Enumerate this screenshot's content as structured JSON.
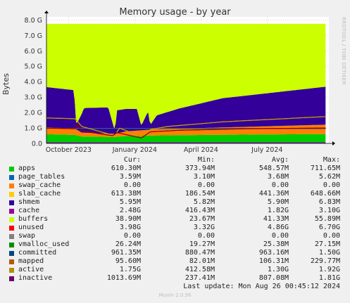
{
  "chart_data": {
    "type": "area",
    "title": "Memory usage - by year",
    "ylabel": "Bytes",
    "side_text": "RRDTOOL / TOBI OETIKER",
    "y_ticks": [
      "0.0",
      "1.0 G",
      "2.0 G",
      "3.0 G",
      "4.0 G",
      "5.0 G",
      "6.0 G",
      "7.0 G",
      "8.0 G"
    ],
    "ylim": [
      0,
      8.2
    ],
    "x_ticks": [
      {
        "label": "October 2023",
        "month": 1.0
      },
      {
        "label": "January 2024",
        "month": 4.0
      },
      {
        "label": "April 2024",
        "month": 7.0
      },
      {
        "label": "July 2024",
        "month": 10.0
      }
    ],
    "xlim": [
      0,
      12.8
    ],
    "grid": true,
    "stack_total_g": 7.75,
    "stack_series": [
      {
        "name": "apps",
        "color": "#00cc00",
        "pts": [
          [
            0,
            0.6
          ],
          [
            1.3,
            0.55
          ],
          [
            1.6,
            0.45
          ],
          [
            3.1,
            0.42
          ],
          [
            3.6,
            0.48
          ],
          [
            5.0,
            0.52
          ],
          [
            8.0,
            0.56
          ],
          [
            12.8,
            0.61
          ]
        ]
      },
      {
        "name": "slab_cache",
        "color": "#ff8000",
        "pts": [
          [
            0,
            0.45
          ],
          [
            1.3,
            0.4
          ],
          [
            1.6,
            0.25
          ],
          [
            3.1,
            0.2
          ],
          [
            3.6,
            0.3
          ],
          [
            5.0,
            0.4
          ],
          [
            9.0,
            0.5
          ],
          [
            12.8,
            0.61
          ]
        ]
      },
      {
        "name": "cache",
        "color": "#330099",
        "pts": [
          [
            0,
            2.6
          ],
          [
            1.25,
            2.5
          ],
          [
            1.35,
            0.3
          ],
          [
            1.7,
            1.6
          ],
          [
            2.8,
            1.7
          ],
          [
            3.1,
            0.2
          ],
          [
            3.2,
            1.5
          ],
          [
            4.1,
            1.4
          ],
          [
            4.3,
            0.3
          ],
          [
            4.6,
            1.2
          ],
          [
            4.7,
            0.3
          ],
          [
            5.0,
            0.9
          ],
          [
            6.0,
            1.3
          ],
          [
            8.0,
            1.9
          ],
          [
            12.8,
            2.48
          ]
        ]
      },
      {
        "name": "unused",
        "color": "#ccff00",
        "pts": [
          [
            0,
            4.1
          ],
          [
            12.8,
            4.05
          ]
        ]
      }
    ],
    "line_series": [
      {
        "name": "committed",
        "color": "#2d5f8a",
        "pts": [
          [
            0,
            0.98
          ],
          [
            12.8,
            0.96
          ]
        ]
      },
      {
        "name": "active",
        "color": "#cc9900",
        "pts": [
          [
            0,
            1.65
          ],
          [
            1.3,
            1.6
          ],
          [
            1.6,
            1.1
          ],
          [
            3.1,
            0.5
          ],
          [
            3.3,
            1.0
          ],
          [
            4.3,
            0.45
          ],
          [
            4.7,
            0.9
          ],
          [
            5.5,
            1.1
          ],
          [
            8.0,
            1.4
          ],
          [
            12.8,
            1.75
          ]
        ]
      },
      {
        "name": "inactive",
        "color": "#990000",
        "pts": [
          [
            0,
            1.0
          ],
          [
            1.3,
            0.95
          ],
          [
            1.4,
            1.25
          ],
          [
            1.6,
            0.8
          ],
          [
            3.0,
            0.5
          ],
          [
            3.2,
            0.7
          ],
          [
            4.3,
            0.35
          ],
          [
            4.7,
            0.75
          ],
          [
            6.0,
            0.85
          ],
          [
            9.0,
            0.95
          ],
          [
            12.8,
            1.0
          ]
        ]
      },
      {
        "name": "buffers",
        "color": "#9900cc",
        "pts": [
          [
            0,
            0.04
          ],
          [
            12.8,
            0.04
          ]
        ]
      }
    ],
    "columns": [
      "Cur:",
      "Min:",
      "Avg:",
      "Max:"
    ],
    "legend": [
      {
        "name": "apps",
        "color": "#00cc00",
        "cur": "610.30M",
        "min": "373.94M",
        "avg": "548.57M",
        "max": "711.65M"
      },
      {
        "name": "page_tables",
        "color": "#0066b3",
        "cur": "3.59M",
        "min": "3.10M",
        "avg": "3.68M",
        "max": "5.62M"
      },
      {
        "name": "swap_cache",
        "color": "#ff8000",
        "cur": "0.00",
        "min": "0.00",
        "avg": "0.00",
        "max": "0.00"
      },
      {
        "name": "slab_cache",
        "color": "#ffcc00",
        "cur": "613.38M",
        "min": "186.54M",
        "avg": "441.36M",
        "max": "648.66M"
      },
      {
        "name": "shmem",
        "color": "#330099",
        "cur": "5.95M",
        "min": "5.82M",
        "avg": "5.90M",
        "max": "6.83M"
      },
      {
        "name": "cache",
        "color": "#990099",
        "cur": "2.48G",
        "min": "416.43M",
        "avg": "1.82G",
        "max": "3.10G"
      },
      {
        "name": "buffers",
        "color": "#ccff00",
        "cur": "38.90M",
        "min": "23.67M",
        "avg": "41.33M",
        "max": "55.89M"
      },
      {
        "name": "unused",
        "color": "#ff0000",
        "cur": "3.98G",
        "min": "3.32G",
        "avg": "4.86G",
        "max": "6.70G"
      },
      {
        "name": "swap",
        "color": "#808080",
        "cur": "0.00",
        "min": "0.00",
        "avg": "0.00",
        "max": "0.00"
      },
      {
        "name": "vmalloc_used",
        "color": "#008f00",
        "cur": "26.24M",
        "min": "19.27M",
        "avg": "25.38M",
        "max": "27.15M"
      },
      {
        "name": "committed",
        "color": "#00487d",
        "cur": "961.35M",
        "min": "880.47M",
        "avg": "963.16M",
        "max": "1.50G"
      },
      {
        "name": "mapped",
        "color": "#b35a00",
        "cur": "95.60M",
        "min": "82.01M",
        "avg": "106.31M",
        "max": "229.77M"
      },
      {
        "name": "active",
        "color": "#b38f00",
        "cur": "1.75G",
        "min": "412.58M",
        "avg": "1.30G",
        "max": "1.92G"
      },
      {
        "name": "inactive",
        "color": "#6b006b",
        "cur": "1013.69M",
        "min": "237.41M",
        "avg": "807.08M",
        "max": "1.81G"
      }
    ]
  },
  "footer": {
    "last_update": "Last update: Mon Aug 26 00:45:12 2024",
    "munin": "Munin 2.0.56"
  }
}
